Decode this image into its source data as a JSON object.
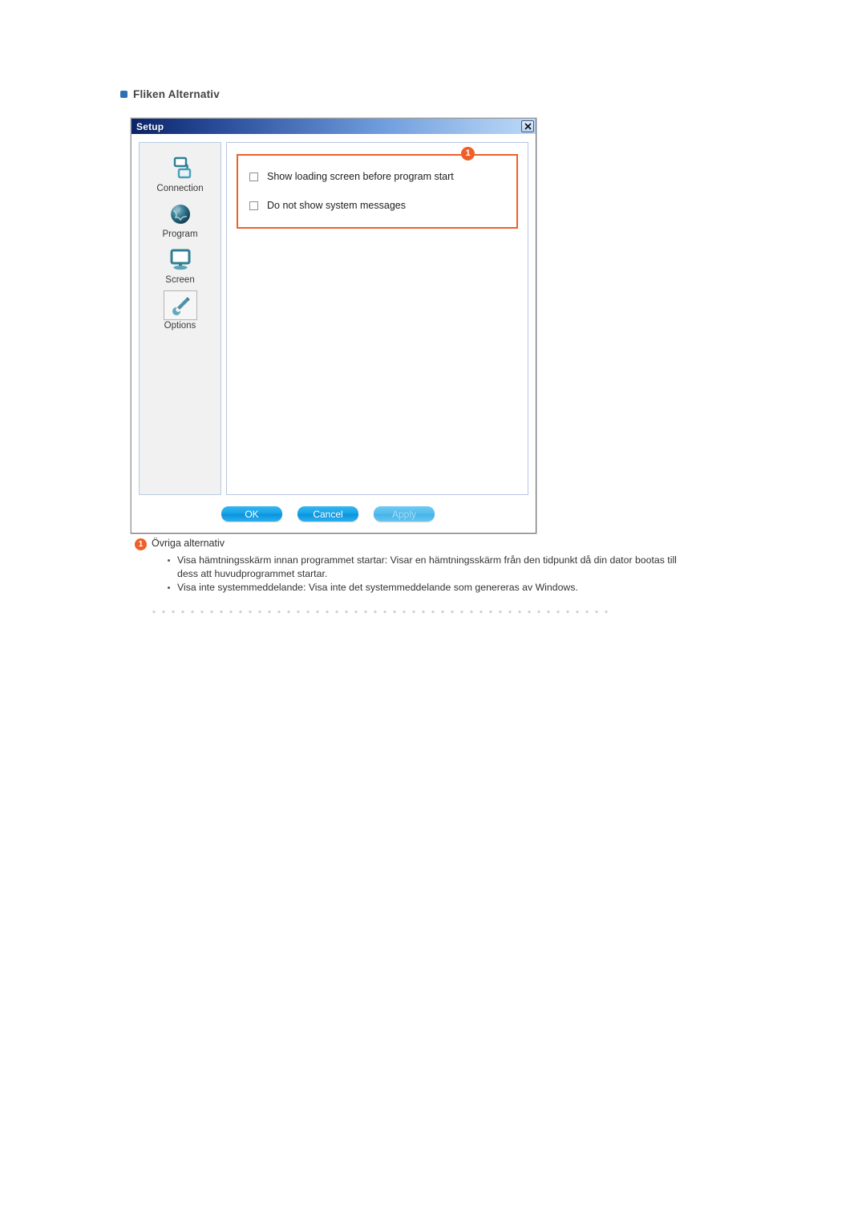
{
  "heading": {
    "bullet_icon": "blue-square-bullet",
    "text": "Fliken Alternativ"
  },
  "dialog": {
    "title": "Setup",
    "close_icon": "close-icon",
    "sidebar": {
      "items": [
        {
          "label": "Connection",
          "icon": "connection-icon",
          "selected": false
        },
        {
          "label": "Program",
          "icon": "globe-icon",
          "selected": false
        },
        {
          "label": "Screen",
          "icon": "monitor-icon",
          "selected": false
        },
        {
          "label": "Options",
          "icon": "wrench-icon",
          "selected": true
        }
      ]
    },
    "options": {
      "callout_number": "1",
      "checkboxes": [
        {
          "label": "Show loading screen before program start",
          "checked": false
        },
        {
          "label": "Do not show system messages",
          "checked": false
        }
      ]
    },
    "buttons": [
      {
        "label": "OK",
        "disabled": false
      },
      {
        "label": "Cancel",
        "disabled": false
      },
      {
        "label": "Apply",
        "disabled": true
      }
    ]
  },
  "caption": {
    "badge": "1",
    "title": "Övriga alternativ",
    "items": [
      "Visa hämtningsskärm innan programmet startar: Visar en hämtningsskärm från den tidpunkt då din dator bootas till dess att huvudprogrammet startar.",
      "Visa inte systemmeddelande: Visa inte det systemmeddelande som genereras av Windows."
    ]
  },
  "colors": {
    "accent_orange": "#ef5f28",
    "title_blue_dark": "#0a246a",
    "title_blue_light": "#bcd8f7",
    "button_blue": "#19a4e8",
    "icon_teal": "#2e7f93"
  }
}
